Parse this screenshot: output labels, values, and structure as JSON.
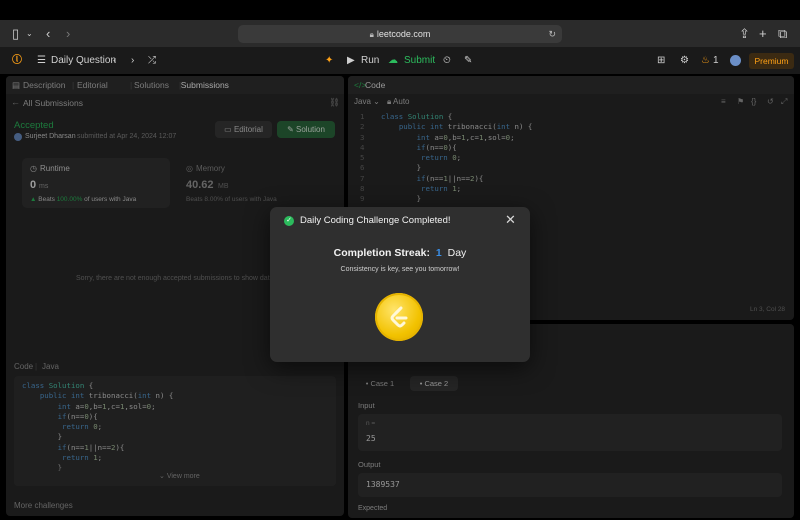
{
  "browser": {
    "url": "leetcode.com"
  },
  "header": {
    "title": "Daily Question",
    "run": "Run",
    "submit": "Submit",
    "streak_count": "1",
    "premium": "Premium"
  },
  "left_tabs": [
    "Description",
    "Editorial",
    "Solutions",
    "Submissions"
  ],
  "submission": {
    "back_label": "All Submissions",
    "status": "Accepted",
    "user": "Surjeet Dharsan",
    "submitted_text": "submitted at Apr 24, 2024 12:07",
    "editorial_btn": "Editorial",
    "solution_btn": "Solution",
    "runtime_label": "Runtime",
    "runtime_value": "0",
    "runtime_unit": "ms",
    "runtime_beats_prefix": "Beats",
    "runtime_beats_pct": "100.00%",
    "runtime_beats_suffix": "of users with Java",
    "memory_label": "Memory",
    "memory_value": "40.62",
    "memory_unit": "MB",
    "memory_beats": "Beats 8.00% of users with Java",
    "sorry_text": "Sorry, there are not enough accepted submissions to show data",
    "code_label": "Code",
    "code_lang": "Java",
    "view_more": "View more",
    "more_challenges": "More challenges"
  },
  "code_panel": {
    "title": "Code",
    "lang": "Java",
    "mode": "Auto",
    "cursor": "Ln 3, Col 28"
  },
  "testcase": {
    "case1": "Case 1",
    "case2": "Case 2",
    "input_label": "Input",
    "input_var": "n =",
    "input_value": "25",
    "output_label": "Output",
    "output_value": "1389537",
    "expected_label": "Expected"
  },
  "modal": {
    "title": "Daily Coding Challenge Completed!",
    "streak_label": "Completion Streak:",
    "streak_value": "1",
    "streak_unit": "Day",
    "message": "Consistency is key, see you tomorrow!"
  },
  "colors": {
    "accepted": "#2cbb5d",
    "accent_orange": "#ffa116",
    "streak_blue": "#3a8ee6",
    "coin_gold": "#f2c200"
  }
}
